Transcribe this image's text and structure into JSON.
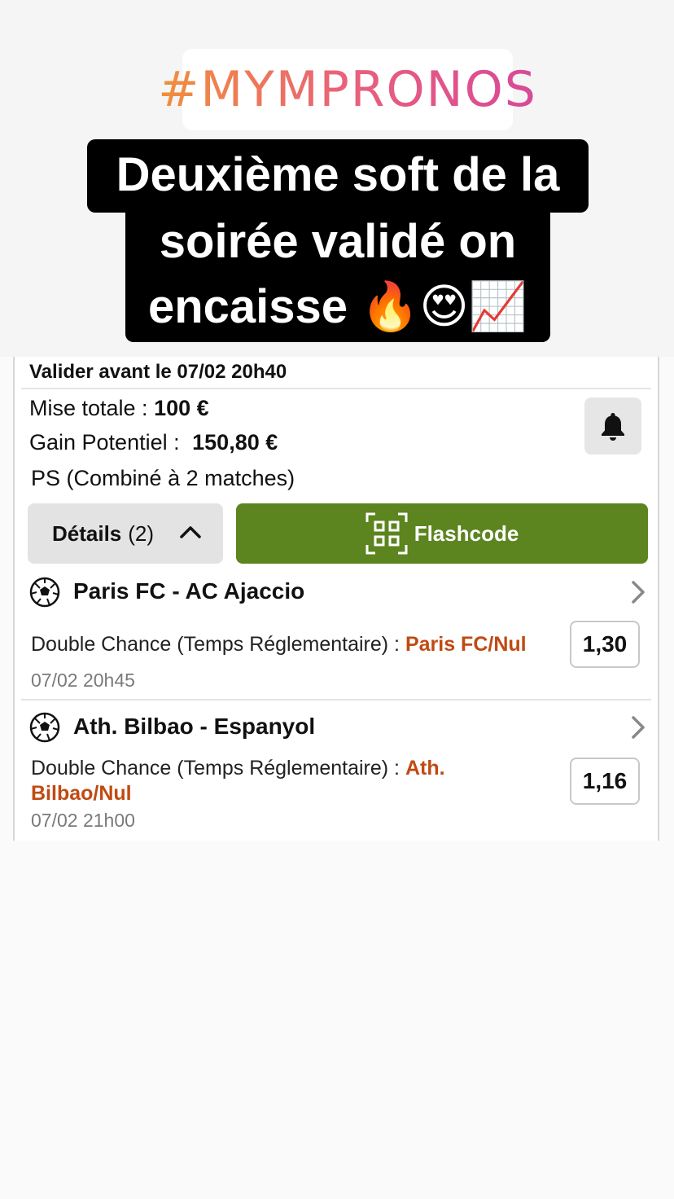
{
  "story": {
    "hashtag": "#MYMPRONOS",
    "caption_lines": [
      "Deuxième soft de la",
      "soirée validé on",
      "encaisse 🔥😍📈"
    ]
  },
  "bet_slip": {
    "valid_before": "Valider avant le 07/02 20h40",
    "mise_label": "Mise totale :",
    "mise_value": "100 €",
    "gain_label": "Gain Potentiel :",
    "gain_value": "150,80 €",
    "bet_type": "PS (Combiné à 2 matches)",
    "details_label": "Détails",
    "details_count": "(2)",
    "flashcode_label": "Flashcode",
    "accent_color": "#5c841f",
    "selection_color": "#c04a12",
    "matches": [
      {
        "title": "Paris FC - AC Ajaccio",
        "market": "Double Chance (Temps Réglementaire) :",
        "selection": "Paris FC/Nul",
        "date": "07/02 20h45",
        "odd": "1,30"
      },
      {
        "title": "Ath. Bilbao - Espanyol",
        "market": "Double Chance (Temps Réglementaire) :",
        "selection": "Ath. Bilbao/Nul",
        "date": "07/02 21h00",
        "odd": "1,16"
      }
    ]
  }
}
